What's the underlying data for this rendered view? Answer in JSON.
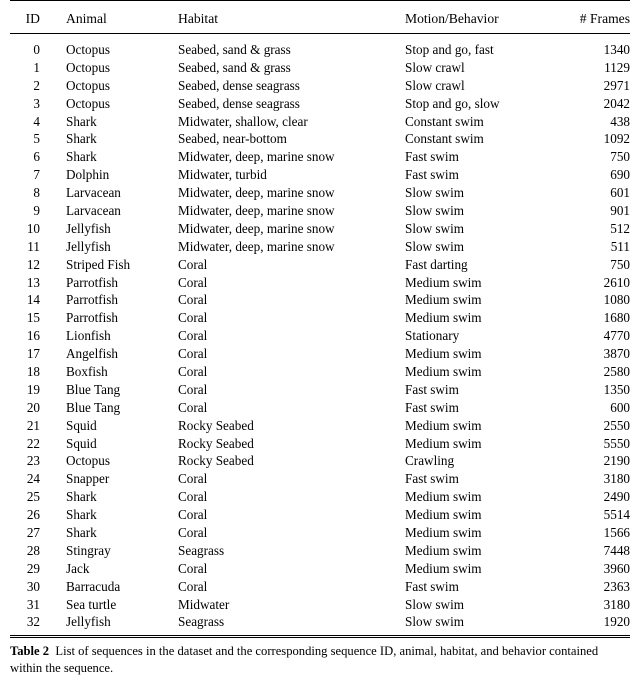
{
  "table": {
    "columns": [
      "ID",
      "Animal",
      "Habitat",
      "Motion/Behavior",
      "# Frames"
    ],
    "rows": [
      {
        "id": "0",
        "animal": "Octopus",
        "habitat": "Seabed, sand & grass",
        "motion": "Stop and go, fast",
        "frames": "1340"
      },
      {
        "id": "1",
        "animal": "Octopus",
        "habitat": "Seabed, sand & grass",
        "motion": "Slow crawl",
        "frames": "1129"
      },
      {
        "id": "2",
        "animal": "Octopus",
        "habitat": "Seabed, dense seagrass",
        "motion": "Slow crawl",
        "frames": "2971"
      },
      {
        "id": "3",
        "animal": "Octopus",
        "habitat": "Seabed, dense seagrass",
        "motion": "Stop and go, slow",
        "frames": "2042"
      },
      {
        "id": "4",
        "animal": "Shark",
        "habitat": "Midwater, shallow, clear",
        "motion": "Constant swim",
        "frames": "438"
      },
      {
        "id": "5",
        "animal": "Shark",
        "habitat": "Seabed, near-bottom",
        "motion": "Constant swim",
        "frames": "1092"
      },
      {
        "id": "6",
        "animal": "Shark",
        "habitat": "Midwater, deep, marine snow",
        "motion": "Fast swim",
        "frames": "750"
      },
      {
        "id": "7",
        "animal": "Dolphin",
        "habitat": "Midwater, turbid",
        "motion": "Fast swim",
        "frames": "690"
      },
      {
        "id": "8",
        "animal": "Larvacean",
        "habitat": "Midwater, deep, marine snow",
        "motion": "Slow swim",
        "frames": "601"
      },
      {
        "id": "9",
        "animal": "Larvacean",
        "habitat": "Midwater, deep, marine snow",
        "motion": "Slow swim",
        "frames": "901"
      },
      {
        "id": "10",
        "animal": "Jellyfish",
        "habitat": "Midwater, deep, marine snow",
        "motion": "Slow swim",
        "frames": "512"
      },
      {
        "id": "11",
        "animal": "Jellyfish",
        "habitat": "Midwater, deep, marine snow",
        "motion": "Slow swim",
        "frames": "511"
      },
      {
        "id": "12",
        "animal": "Striped Fish",
        "habitat": "Coral",
        "motion": "Fast darting",
        "frames": "750"
      },
      {
        "id": "13",
        "animal": "Parrotfish",
        "habitat": "Coral",
        "motion": "Medium swim",
        "frames": "2610"
      },
      {
        "id": "14",
        "animal": "Parrotfish",
        "habitat": "Coral",
        "motion": "Medium swim",
        "frames": "1080"
      },
      {
        "id": "15",
        "animal": "Parrotfish",
        "habitat": "Coral",
        "motion": "Medium swim",
        "frames": "1680"
      },
      {
        "id": "16",
        "animal": "Lionfish",
        "habitat": "Coral",
        "motion": "Stationary",
        "frames": "4770"
      },
      {
        "id": "17",
        "animal": "Angelfish",
        "habitat": "Coral",
        "motion": "Medium swim",
        "frames": "3870"
      },
      {
        "id": "18",
        "animal": "Boxfish",
        "habitat": "Coral",
        "motion": "Medium swim",
        "frames": "2580"
      },
      {
        "id": "19",
        "animal": "Blue Tang",
        "habitat": "Coral",
        "motion": "Fast swim",
        "frames": "1350"
      },
      {
        "id": "20",
        "animal": "Blue Tang",
        "habitat": "Coral",
        "motion": "Fast swim",
        "frames": "600"
      },
      {
        "id": "21",
        "animal": "Squid",
        "habitat": "Rocky Seabed",
        "motion": "Medium swim",
        "frames": "2550"
      },
      {
        "id": "22",
        "animal": "Squid",
        "habitat": "Rocky Seabed",
        "motion": "Medium swim",
        "frames": "5550"
      },
      {
        "id": "23",
        "animal": "Octopus",
        "habitat": "Rocky Seabed",
        "motion": "Crawling",
        "frames": "2190"
      },
      {
        "id": "24",
        "animal": "Snapper",
        "habitat": "Coral",
        "motion": "Fast swim",
        "frames": "3180"
      },
      {
        "id": "25",
        "animal": "Shark",
        "habitat": "Coral",
        "motion": "Medium swim",
        "frames": "2490"
      },
      {
        "id": "26",
        "animal": "Shark",
        "habitat": "Coral",
        "motion": "Medium swim",
        "frames": "5514"
      },
      {
        "id": "27",
        "animal": "Shark",
        "habitat": "Coral",
        "motion": "Medium swim",
        "frames": "1566"
      },
      {
        "id": "28",
        "animal": "Stingray",
        "habitat": "Seagrass",
        "motion": "Medium swim",
        "frames": "7448"
      },
      {
        "id": "29",
        "animal": "Jack",
        "habitat": "Coral",
        "motion": "Medium swim",
        "frames": "3960"
      },
      {
        "id": "30",
        "animal": "Barracuda",
        "habitat": "Coral",
        "motion": "Fast swim",
        "frames": "2363"
      },
      {
        "id": "31",
        "animal": "Sea turtle",
        "habitat": "Midwater",
        "motion": "Slow swim",
        "frames": "3180"
      },
      {
        "id": "32",
        "animal": "Jellyfish",
        "habitat": "Seagrass",
        "motion": "Slow swim",
        "frames": "1920"
      }
    ]
  },
  "caption": {
    "label": "Table 2",
    "text": "List of sequences in the dataset and the corresponding sequence ID, animal, habitat, and behavior contained within the sequence."
  }
}
